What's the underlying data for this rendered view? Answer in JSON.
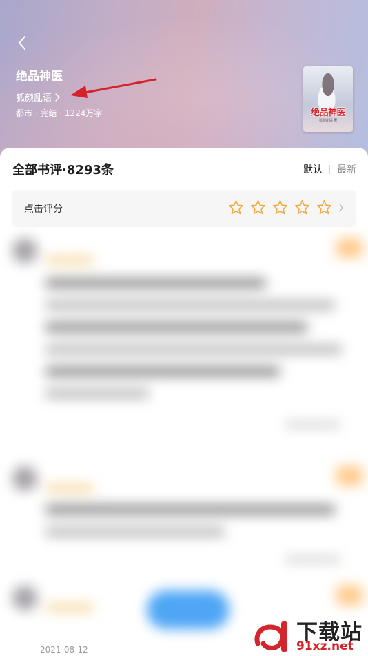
{
  "header": {
    "book_title": "绝品神医",
    "author": "狐颜乱语",
    "meta": "都市 · 完结 · 1224万字",
    "cover": {
      "title": "绝品神医",
      "subtitle": "狐颜乱语 著"
    }
  },
  "reviews": {
    "title": "全部书评·8293条",
    "sort": {
      "default_label": "默认",
      "latest_label": "最新"
    },
    "rate": {
      "label": "点击评分",
      "stars": 5,
      "filled": 0
    },
    "date_partial": "2021-08-12"
  },
  "watermark": {
    "title": "下载站",
    "url": "91xz.net",
    "logo_text": "9"
  },
  "colors": {
    "star_outline": "#f2a93b",
    "annotation_arrow": "#d4232b",
    "accent_blue": "#4ea6f5"
  }
}
